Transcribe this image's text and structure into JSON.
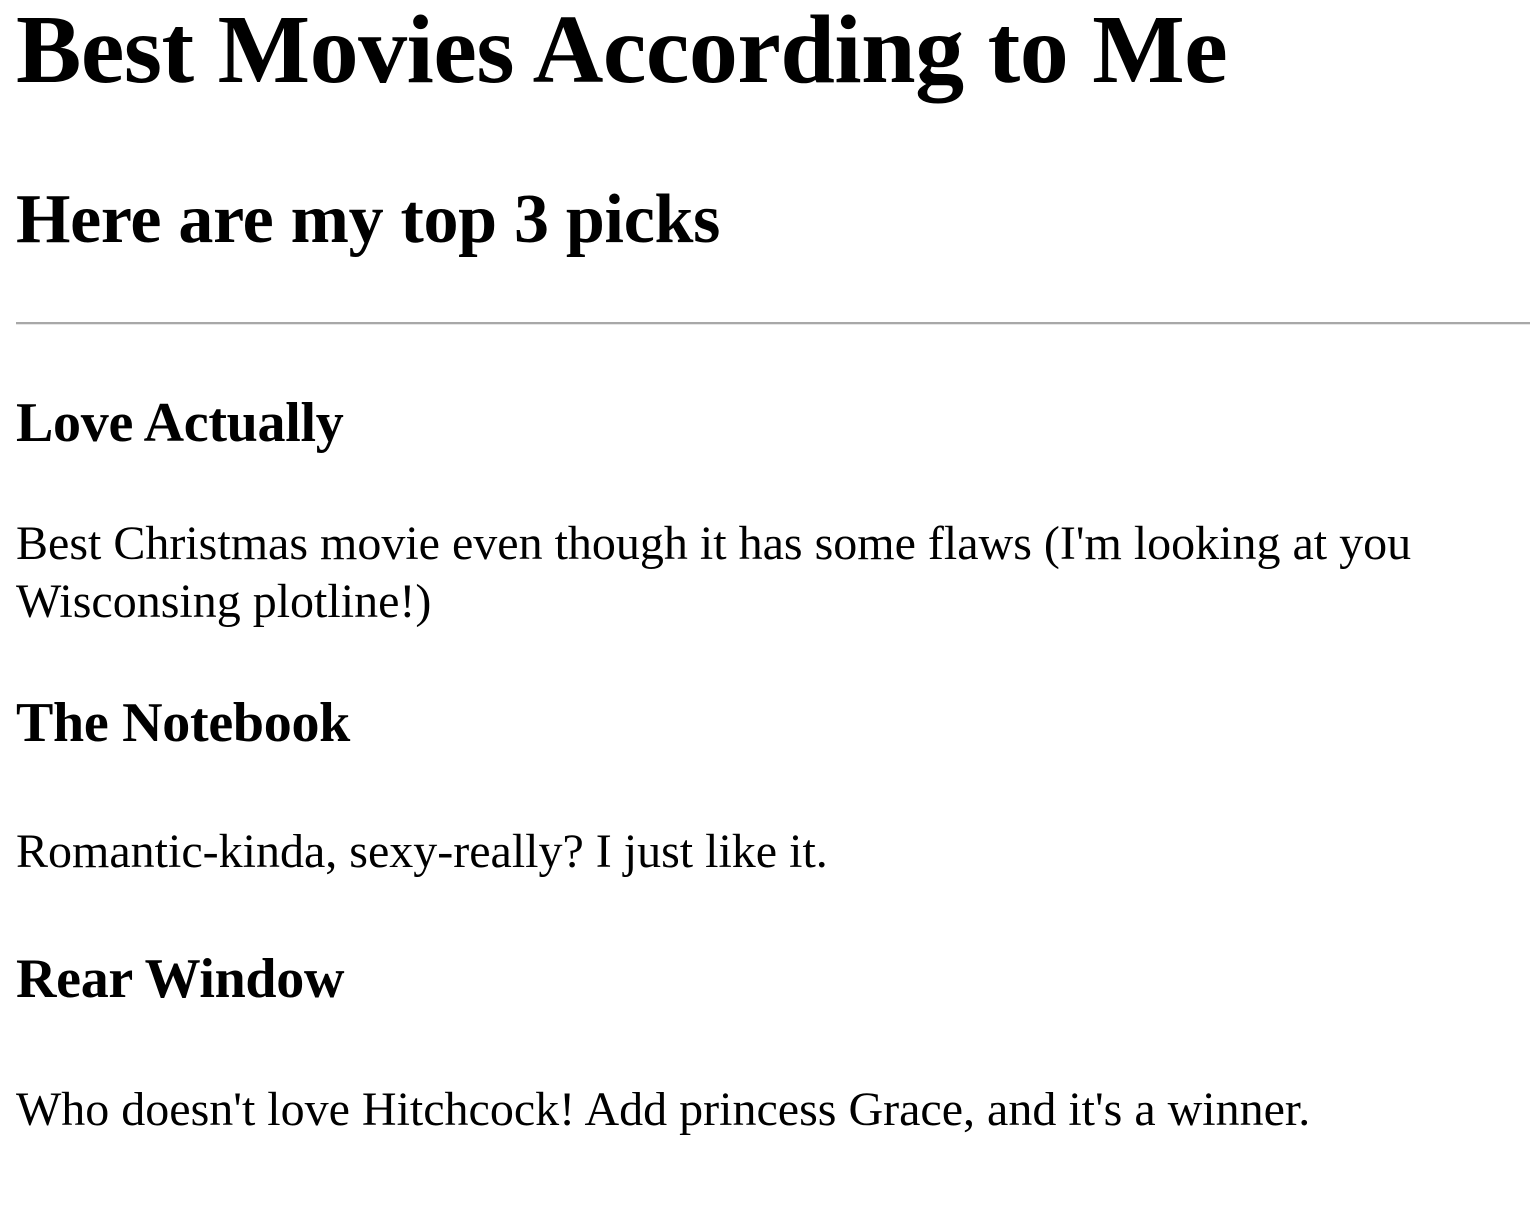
{
  "page": {
    "title": "Best Movies According to Me",
    "subtitle": "Here are my top 3 picks"
  },
  "movies": [
    {
      "title": "Love Actually",
      "description": "Best Christmas movie even though it has some flaws (I'm looking at you Wisconsing plotline!)"
    },
    {
      "title": "The Notebook",
      "description": "Romantic-kinda, sexy-really? I just like it."
    },
    {
      "title": "Rear Window",
      "description": "Who doesn't love Hitchcock! Add princess Grace, and it's a winner."
    }
  ]
}
